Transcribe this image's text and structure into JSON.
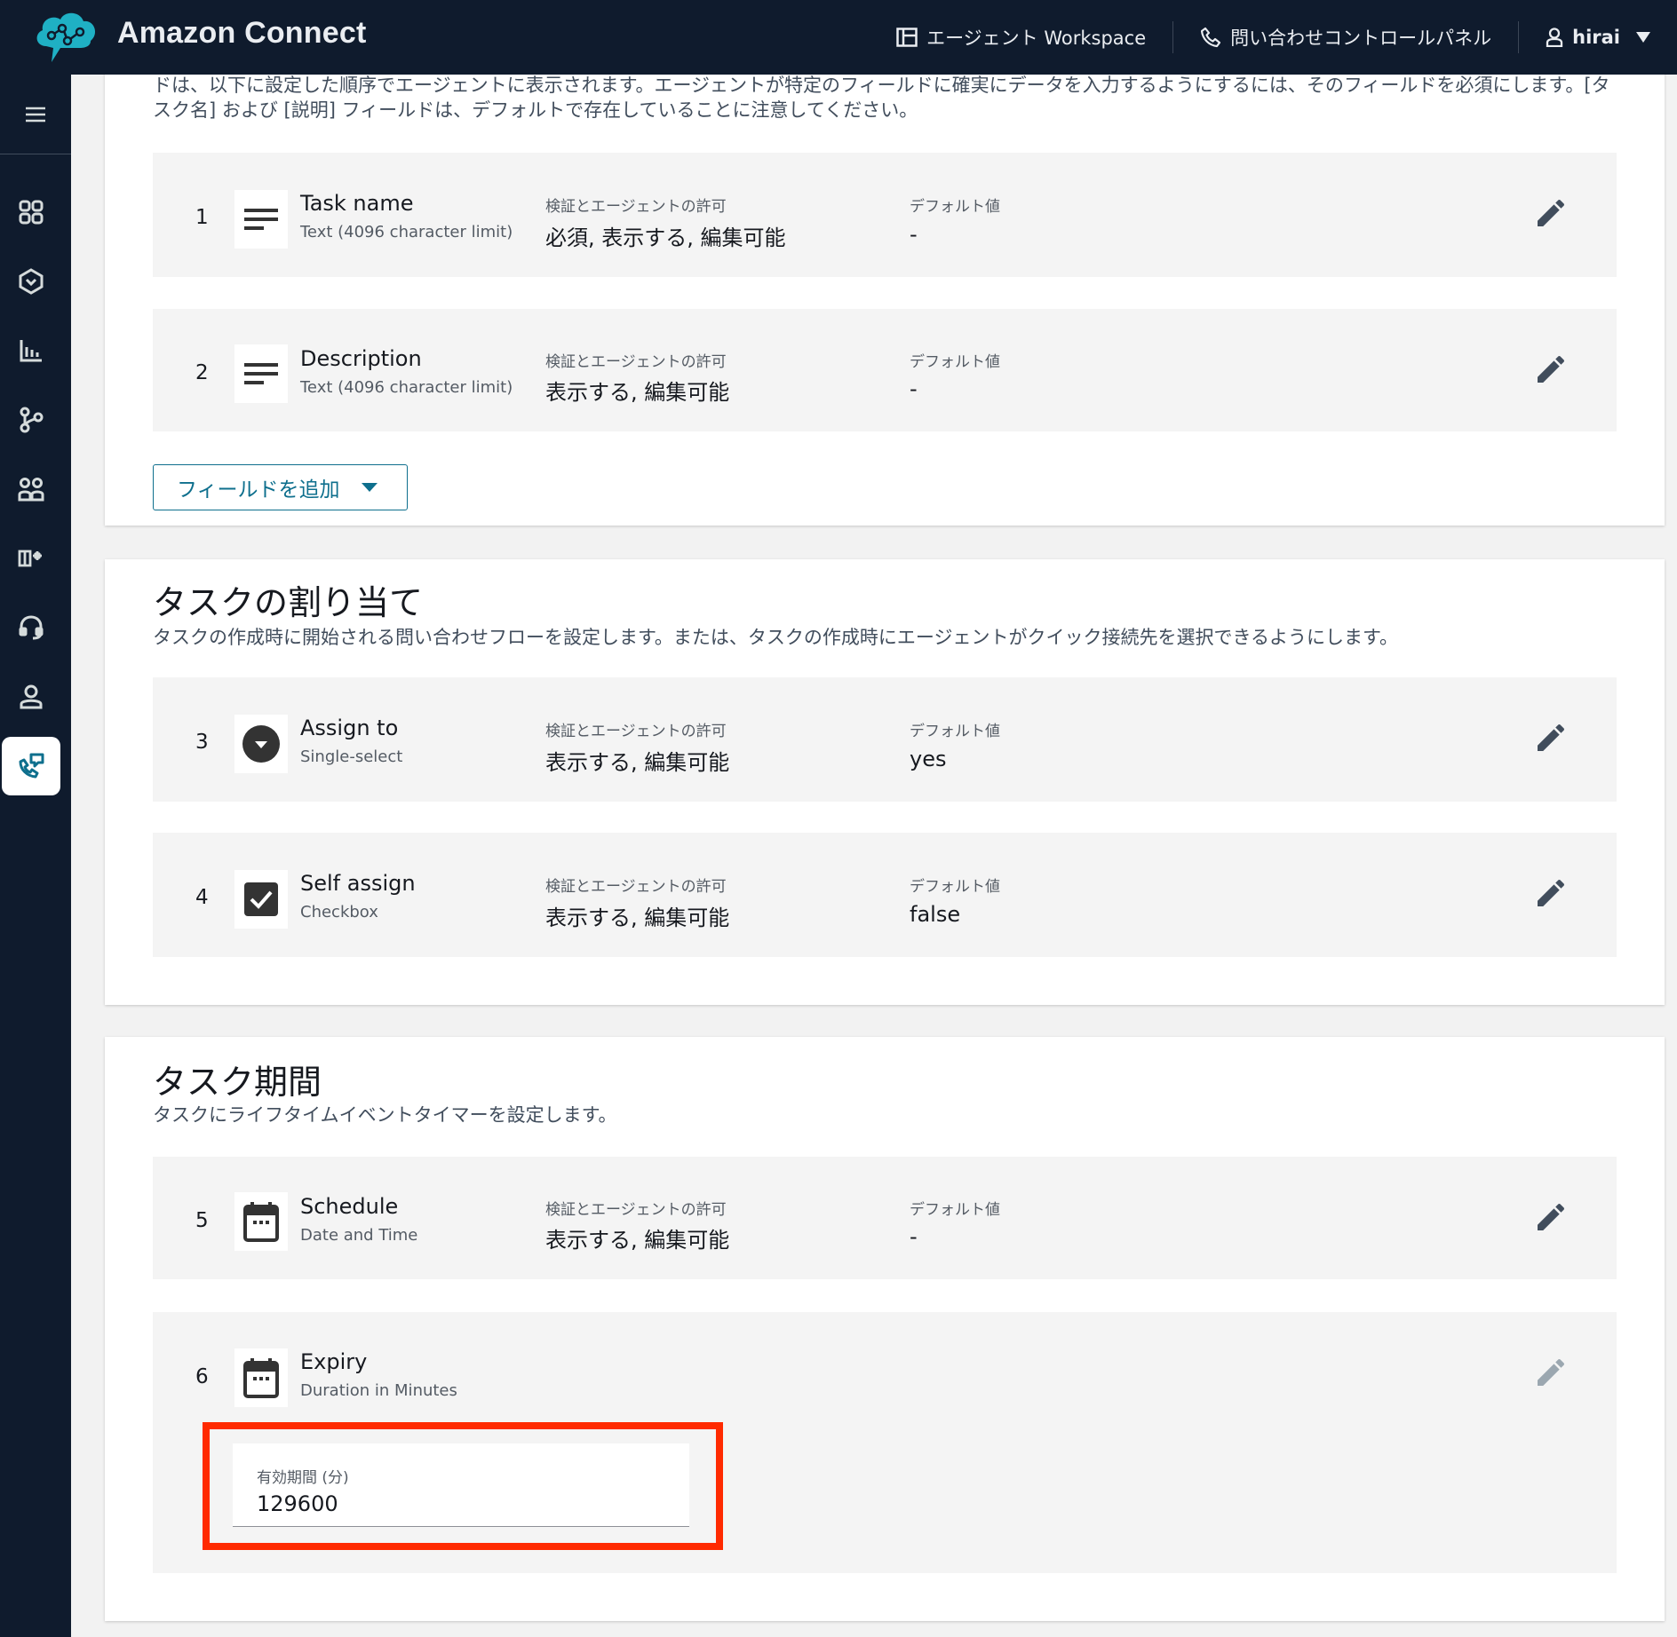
{
  "header": {
    "brand": "Amazon Connect",
    "nav": [
      {
        "label": "エージェント Workspace",
        "icon": "workspace-icon"
      },
      {
        "label": "問い合わせコントロールパネル",
        "icon": "phone-icon"
      },
      {
        "label": "hirai",
        "icon": "user-icon"
      }
    ]
  },
  "sidebar": {
    "menu_icon": "hamburger-menu-icon",
    "items": [
      {
        "icon": "dashboard-icon",
        "active": false
      },
      {
        "icon": "routing-icon",
        "active": false
      },
      {
        "icon": "analytics-icon",
        "active": false
      },
      {
        "icon": "flows-icon",
        "active": false
      },
      {
        "icon": "users-icon",
        "active": false
      },
      {
        "icon": "campaigns-icon",
        "active": false
      },
      {
        "icon": "headset-icon",
        "active": false
      },
      {
        "icon": "customer-profile-icon",
        "active": false
      },
      {
        "icon": "channels-icon",
        "active": true
      }
    ]
  },
  "fields_section": {
    "intro": "ドは、以下に設定した順序でエージェントに表示されます。エージェントが特定のフィールドに確実にデータを入力するようにするには、そのフィールドを必須にします。[タスク名] および [説明] フィールドは、デフォルトで存在していることに注意してください。",
    "add_field_label": "フィールドを追加"
  },
  "labels": {
    "permissions": "検証とエージェントの許可",
    "default_value": "デフォルト値"
  },
  "assignment_section": {
    "title": "タスクの割り当て",
    "description": "タスクの作成時に開始される問い合わせフローを設定します。または、タスクの作成時にエージェントがクイック接続先を選択できるようにします。"
  },
  "duration_section": {
    "title": "タスク期間",
    "description": "タスクにライフタイムイベントタイマーを設定します。"
  },
  "fields": [
    {
      "num": "1",
      "name": "Task name",
      "type": "Text (4096 character limit)",
      "permissions": "必須, 表示する, 編集可能",
      "default": "-",
      "icon": "text-lines-icon",
      "editable": true
    },
    {
      "num": "2",
      "name": "Description",
      "type": "Text (4096 character limit)",
      "permissions": "表示する, 編集可能",
      "default": "-",
      "icon": "text-lines-icon",
      "editable": true
    },
    {
      "num": "3",
      "name": "Assign to",
      "type": "Single-select",
      "permissions": "表示する, 編集可能",
      "default": "yes",
      "icon": "dropdown-circle-icon",
      "editable": true
    },
    {
      "num": "4",
      "name": "Self assign",
      "type": "Checkbox",
      "permissions": "表示する, 編集可能",
      "default": "false",
      "icon": "checkbox-icon",
      "editable": true
    },
    {
      "num": "5",
      "name": "Schedule",
      "type": "Date and Time",
      "permissions": "表示する, 編集可能",
      "default": "-",
      "icon": "calendar-icon",
      "editable": true
    },
    {
      "num": "6",
      "name": "Expiry",
      "type": "Duration in Minutes",
      "icon": "calendar-icon",
      "editable": false
    }
  ],
  "expiry_input": {
    "label": "有効期間 (分)",
    "value": "129600"
  },
  "colors": {
    "topbar": "#0f1b2d",
    "accent": "#0e6f8d",
    "highlight": "#ff2a00",
    "edit_icon": "#414d5c",
    "edit_icon_disabled": "#9ba7b0"
  }
}
